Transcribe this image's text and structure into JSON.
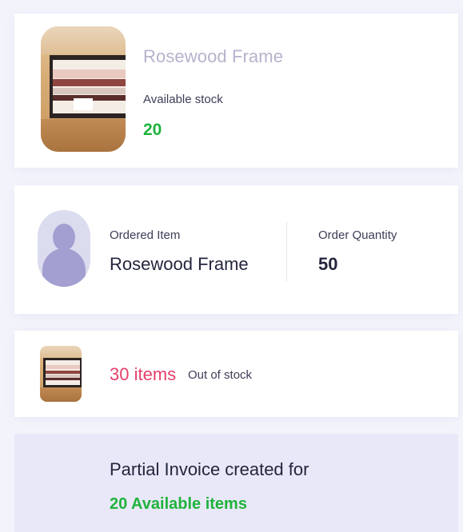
{
  "product_card": {
    "image_name": "rosewood-frame-photo",
    "title": "Rosewood Frame",
    "stock_label": "Available stock",
    "stock_value": "20"
  },
  "order_card": {
    "ordered_item_label": "Ordered Item",
    "ordered_item_value": "Rosewood Frame",
    "quantity_label": "Order Quantity",
    "quantity_value": "50"
  },
  "out_of_stock_card": {
    "count_text": "30 items",
    "status_text": "Out of stock"
  },
  "invoice_banner": {
    "line1": "Partial Invoice created for",
    "line2": "20 Available items"
  },
  "colors": {
    "available_green": "#1fb33c",
    "out_of_stock_red": "#e5406b",
    "banner_bg": "#e9e8f8"
  }
}
